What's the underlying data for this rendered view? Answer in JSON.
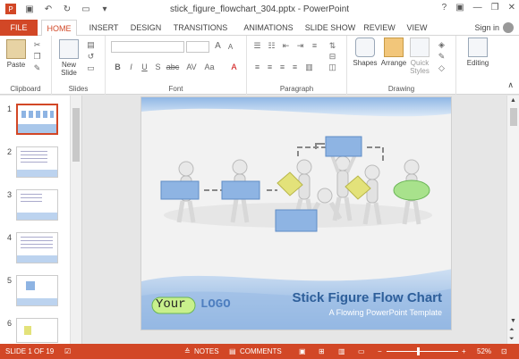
{
  "window": {
    "title": "stick_figure_flowchart_304.pptx - PowerPoint",
    "controls": [
      "?",
      "▣",
      "—",
      "❐",
      "✕"
    ]
  },
  "tabs": [
    "FILE",
    "HOME",
    "INSERT",
    "DESIGN",
    "TRANSITIONS",
    "ANIMATIONS",
    "SLIDE SHOW",
    "REVIEW",
    "VIEW"
  ],
  "signin": "Sign in",
  "ribbon": {
    "clipboard": {
      "label": "Clipboard",
      "paste": "Paste"
    },
    "slides": {
      "label": "Slides",
      "new_slide": "New Slide"
    },
    "font": {
      "label": "Font",
      "bold": "B",
      "italic": "I",
      "underline": "U",
      "strike": "S",
      "shadow": "abc",
      "spacing": "AV",
      "case": "Aa",
      "grow": "A",
      "shrink": "A"
    },
    "paragraph": {
      "label": "Paragraph"
    },
    "drawing": {
      "label": "Drawing",
      "shapes": "Shapes",
      "arrange": "Arrange",
      "quick_styles": "Quick Styles"
    },
    "editing": {
      "label": "Editing"
    }
  },
  "thumbnails": [
    "1",
    "2",
    "3",
    "4",
    "5",
    "6"
  ],
  "slide": {
    "title": "Stick Figure Flow Chart",
    "subtitle": "A Flowing PowerPoint Template",
    "logo_your": "Your",
    "logo_logo": "LOGO"
  },
  "status": {
    "slide_of": "SLIDE 1 OF 19",
    "notes": "NOTES",
    "comments": "COMMENTS",
    "zoom": "52%"
  },
  "colors": {
    "accent": "#d24726",
    "board_blue": "#8eb4e3",
    "board_yellow": "#e3e27a",
    "board_green": "#a8e28c",
    "title_blue": "#2e5f9a"
  }
}
